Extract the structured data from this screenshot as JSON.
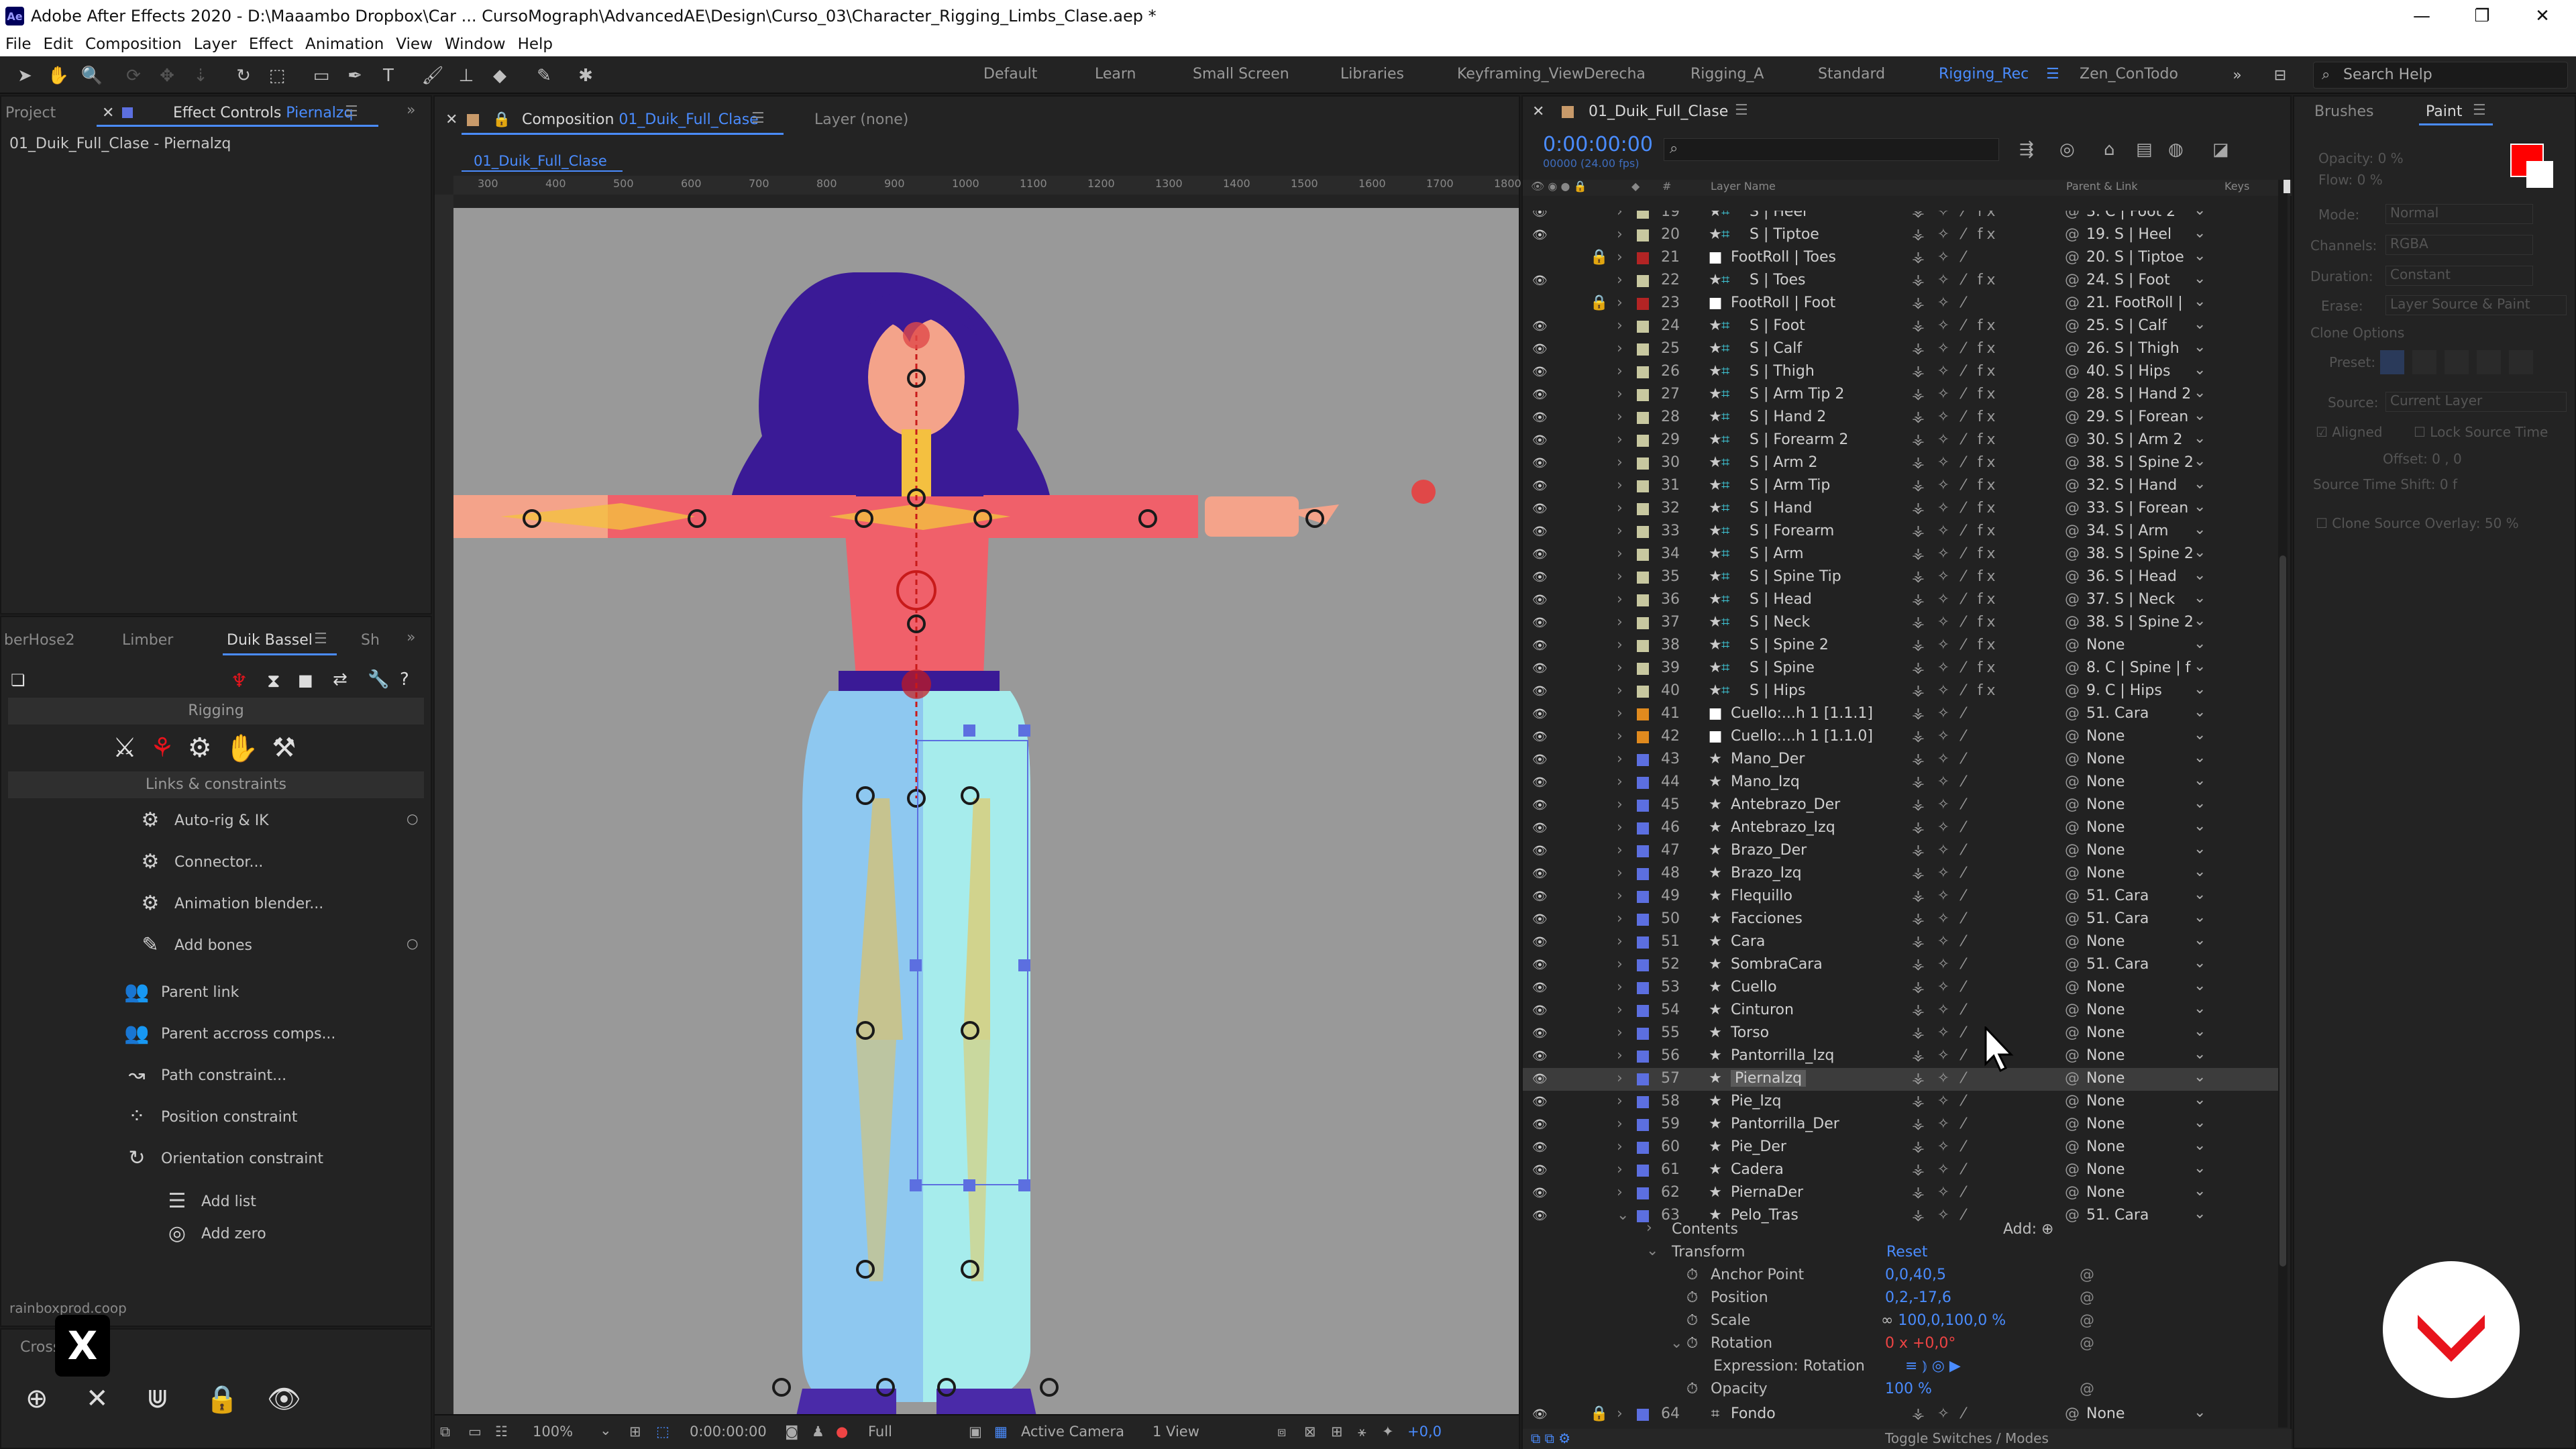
{
  "window": {
    "title": "Adobe After Effects 2020 - D:\\Maaambo Dropbox\\Car ... CursoMograph\\AdvancedAE\\Design\\Curso_03\\Character_Rigging_Limbs_Clase.aep *",
    "logo": "Ae",
    "controls": [
      "—",
      "❐",
      "✕"
    ]
  },
  "menu": [
    "File",
    "Edit",
    "Composition",
    "Layer",
    "Effect",
    "Animation",
    "View",
    "Window",
    "Help"
  ],
  "workspaces": [
    {
      "label": "Default",
      "active": false
    },
    {
      "label": "Learn",
      "active": false
    },
    {
      "label": "Small Screen",
      "active": false
    },
    {
      "label": "Libraries",
      "active": false
    },
    {
      "label": "Keyframing_ViewDerecha",
      "active": false
    },
    {
      "label": "Rigging_A",
      "active": false
    },
    {
      "label": "Standard",
      "active": false
    },
    {
      "label": "Rigging_Rec",
      "active": true
    },
    {
      "label": "Zen_ConTodo",
      "active": false
    }
  ],
  "search_help": "Search Help",
  "left_panel": {
    "tab_project": "Project",
    "tab_effect_controls": "Effect Controls",
    "effect_layer": "Piernalzq",
    "breadcrumb": "01_Duik_Full_Clase - Piernalzq"
  },
  "duik_panel": {
    "tabs": [
      "berHose2",
      "Limber",
      "Duik Bassel",
      "Sh"
    ],
    "section_rigging": "Rigging",
    "section_links": "Links & constraints",
    "items": [
      {
        "label": "Auto-rig & IK",
        "icon": "auto-rig-icon",
        "glyph": "⚙"
      },
      {
        "label": "Connector...",
        "icon": "connector-icon",
        "glyph": "⚙"
      },
      {
        "label": "Animation blender...",
        "icon": "blender-icon",
        "glyph": "⚙"
      },
      {
        "label": "Add bones",
        "icon": "bone-icon",
        "glyph": "✎"
      },
      {
        "label": "Parent link",
        "icon": "parent-link-icon",
        "glyph": "👥"
      },
      {
        "label": "Parent accross comps...",
        "icon": "parent-comps-icon",
        "glyph": "👥"
      },
      {
        "label": "Path constraint...",
        "icon": "path-constraint-icon",
        "glyph": "↝"
      },
      {
        "label": "Position constraint",
        "icon": "position-constraint-icon",
        "glyph": "⁘"
      },
      {
        "label": "Orientation constraint",
        "icon": "orientation-constraint-icon",
        "glyph": "↻"
      },
      {
        "label": "Add list",
        "icon": "list-icon",
        "glyph": "☰"
      },
      {
        "label": "Add zero",
        "icon": "zero-icon",
        "glyph": "◎"
      }
    ],
    "footer": "rainboxprod.coop",
    "crosshair_tab": "Crossh"
  },
  "composition_panel": {
    "tab_prefix": "Composition",
    "comp_name": "01_Duik_Full_Clase",
    "layer_tab": "Layer (none)",
    "sub_tab": "01_Duik_Full_Clase",
    "ruler_marks": [
      "300",
      "400",
      "500",
      "600",
      "700",
      "800",
      "900",
      "1000",
      "1100",
      "1200",
      "1300",
      "1400",
      "1500",
      "1600",
      "1700",
      "1800"
    ],
    "footer": {
      "zoom": "100%",
      "timecode": "0:00:00:00",
      "resolution": "Full",
      "camera": "Active Camera",
      "view": "1 View",
      "exposure": "+0,0"
    }
  },
  "timeline": {
    "comp_tab": "01_Duik_Full_Clase",
    "timecode": "0:00:00:00",
    "fps_note": "00000 (24.00 fps)",
    "header_layer_name": "Layer Name",
    "header_parent": "Parent & Link",
    "header_keys": "Keys",
    "layers": [
      {
        "num": "19",
        "name": "S | Heel",
        "color": "#c8c8a0",
        "star": true,
        "parent": "3. C | Foot 2"
      },
      {
        "num": "20",
        "name": "S | Tiptoe",
        "color": "#c8c8a0",
        "star": true,
        "parent": "19. S | Heel"
      },
      {
        "num": "21",
        "name": "FootRoll | Toes",
        "color": "#b32424",
        "star": false,
        "parent": "20. S | Tiptoe"
      },
      {
        "num": "22",
        "name": "S | Toes",
        "color": "#c8c8a0",
        "star": true,
        "parent": "24. S | Foot"
      },
      {
        "num": "23",
        "name": "FootRoll | Foot",
        "color": "#b32424",
        "star": false,
        "parent": "21. FootRoll |"
      },
      {
        "num": "24",
        "name": "S | Foot",
        "color": "#c8c8a0",
        "star": true,
        "parent": "25. S | Calf"
      },
      {
        "num": "25",
        "name": "S | Calf",
        "color": "#c8c8a0",
        "star": true,
        "parent": "26. S | Thigh"
      },
      {
        "num": "26",
        "name": "S | Thigh",
        "color": "#c8c8a0",
        "star": true,
        "parent": "40. S | Hips"
      },
      {
        "num": "27",
        "name": "S | Arm Tip 2",
        "color": "#c8c8a0",
        "star": true,
        "parent": "28. S | Hand 2"
      },
      {
        "num": "28",
        "name": "S | Hand 2",
        "color": "#c8c8a0",
        "star": true,
        "parent": "29. S | Forean"
      },
      {
        "num": "29",
        "name": "S | Forearm 2",
        "color": "#c8c8a0",
        "star": true,
        "parent": "30. S | Arm 2"
      },
      {
        "num": "30",
        "name": "S | Arm 2",
        "color": "#c8c8a0",
        "star": true,
        "parent": "38. S | Spine 2"
      },
      {
        "num": "31",
        "name": "S | Arm Tip",
        "color": "#c8c8a0",
        "star": true,
        "parent": "32. S | Hand"
      },
      {
        "num": "32",
        "name": "S | Hand",
        "color": "#c8c8a0",
        "star": true,
        "parent": "33. S | Forean"
      },
      {
        "num": "33",
        "name": "S | Forearm",
        "color": "#c8c8a0",
        "star": true,
        "parent": "34. S | Arm"
      },
      {
        "num": "34",
        "name": "S | Arm",
        "color": "#c8c8a0",
        "star": true,
        "parent": "38. S | Spine 2"
      },
      {
        "num": "35",
        "name": "S | Spine Tip",
        "color": "#c8c8a0",
        "star": true,
        "parent": "36. S | Head"
      },
      {
        "num": "36",
        "name": "S | Head",
        "color": "#c8c8a0",
        "star": true,
        "parent": "37. S | Neck"
      },
      {
        "num": "37",
        "name": "S | Neck",
        "color": "#c8c8a0",
        "star": true,
        "parent": "38. S | Spine 2"
      },
      {
        "num": "38",
        "name": "S | Spine 2",
        "color": "#c8c8a0",
        "star": true,
        "parent": "None"
      },
      {
        "num": "39",
        "name": "S | Spine",
        "color": "#c8c8a0",
        "star": true,
        "parent": "8. C | Spine | f"
      },
      {
        "num": "40",
        "name": "S | Hips",
        "color": "#c8c8a0",
        "star": true,
        "parent": "9. C | Hips"
      },
      {
        "num": "41",
        "name": "Cuello:...h 1 [1.1.1]",
        "color": "#e08a1e",
        "star": false,
        "parent": "51. Cara"
      },
      {
        "num": "42",
        "name": "Cuello:...h 1 [1.1.0]",
        "color": "#e08a1e",
        "star": false,
        "parent": "None"
      },
      {
        "num": "43",
        "name": "Mano_Der",
        "color": "#5c6fe0",
        "star": true,
        "parent": "None"
      },
      {
        "num": "44",
        "name": "Mano_Izq",
        "color": "#5c6fe0",
        "star": true,
        "parent": "None"
      },
      {
        "num": "45",
        "name": "Antebrazo_Der",
        "color": "#5c6fe0",
        "star": true,
        "parent": "None"
      },
      {
        "num": "46",
        "name": "Antebrazo_Izq",
        "color": "#5c6fe0",
        "star": true,
        "parent": "None"
      },
      {
        "num": "47",
        "name": "Brazo_Der",
        "color": "#5c6fe0",
        "star": true,
        "parent": "None"
      },
      {
        "num": "48",
        "name": "Brazo_Izq",
        "color": "#5c6fe0",
        "star": true,
        "parent": "None"
      },
      {
        "num": "49",
        "name": "Flequillo",
        "color": "#5c6fe0",
        "star": true,
        "parent": "51. Cara"
      },
      {
        "num": "50",
        "name": "Facciones",
        "color": "#5c6fe0",
        "star": true,
        "parent": "51. Cara"
      },
      {
        "num": "51",
        "name": "Cara",
        "color": "#5c6fe0",
        "star": true,
        "parent": "None"
      },
      {
        "num": "52",
        "name": "SombraCara",
        "color": "#5c6fe0",
        "star": true,
        "parent": "51. Cara"
      },
      {
        "num": "53",
        "name": "Cuello",
        "color": "#5c6fe0",
        "star": true,
        "parent": "None"
      },
      {
        "num": "54",
        "name": "Cinturon",
        "color": "#5c6fe0",
        "star": true,
        "parent": "None"
      },
      {
        "num": "55",
        "name": "Torso",
        "color": "#5c6fe0",
        "star": true,
        "parent": "None"
      },
      {
        "num": "56",
        "name": "Pantorrilla_Izq",
        "color": "#5c6fe0",
        "star": true,
        "parent": "None"
      },
      {
        "num": "57",
        "name": "Piernalzq",
        "color": "#5c6fe0",
        "star": true,
        "parent": "None",
        "selected": true
      },
      {
        "num": "58",
        "name": "Pie_Izq",
        "color": "#5c6fe0",
        "star": true,
        "parent": "None"
      },
      {
        "num": "59",
        "name": "Pantorrilla_Der",
        "color": "#5c6fe0",
        "star": true,
        "parent": "None"
      },
      {
        "num": "60",
        "name": "Pie_Der",
        "color": "#5c6fe0",
        "star": true,
        "parent": "None"
      },
      {
        "num": "61",
        "name": "Cadera",
        "color": "#5c6fe0",
        "star": true,
        "parent": "None"
      },
      {
        "num": "62",
        "name": "PiernaDer",
        "color": "#5c6fe0",
        "star": true,
        "parent": "None"
      },
      {
        "num": "63",
        "name": "Pelo_Tras",
        "color": "#5c6fe0",
        "star": true,
        "parent": "51. Cara"
      }
    ],
    "expanded": {
      "contents": "Contents",
      "add_label": "Add:",
      "transform": "Transform",
      "reset": "Reset",
      "anchor_label": "Anchor Point",
      "anchor_value": "0,0,40,5",
      "position_label": "Position",
      "position_value": "0,2,-17,6",
      "scale_label": "Scale",
      "scale_value": "100,0,100,0 %",
      "rotation_label": "Rotation",
      "rotation_value": "0 x +0,0°",
      "expression_label": "Expression: Rotation",
      "opacity_label": "Opacity",
      "opacity_value": "100 %"
    },
    "last_layer": {
      "num": "64",
      "name": "Fondo",
      "parent": "None"
    },
    "footer": "Toggle Switches / Modes"
  },
  "paint_panel": {
    "tab_brushes": "Brushes",
    "tab_paint": "Paint",
    "opacity": "Opacity: 0 %",
    "flow": "Flow: 0 %",
    "mode_label": "Mode:",
    "mode_value": "Normal",
    "channels_label": "Channels:",
    "channels_value": "RGBA",
    "duration_label": "Duration:",
    "duration_value": "Constant",
    "erase_label": "Erase:",
    "erase_value": "Layer Source & Paint",
    "clone_options": "Clone Options",
    "preset_label": "Preset:",
    "source_label": "Source:",
    "source_value": "Current Layer",
    "aligned": "Aligned",
    "lock_source": "Lock Source Time",
    "offset": "Offset: 0 , 0",
    "source_time_shift": "Source Time Shift: 0 f",
    "clone_overlay": "Clone Source Overlay:",
    "clone_overlay_value": "50 %",
    "fg_color": "#ff0000",
    "bg_color": "#ffffff"
  },
  "brand_badge_color": "#e8141d"
}
